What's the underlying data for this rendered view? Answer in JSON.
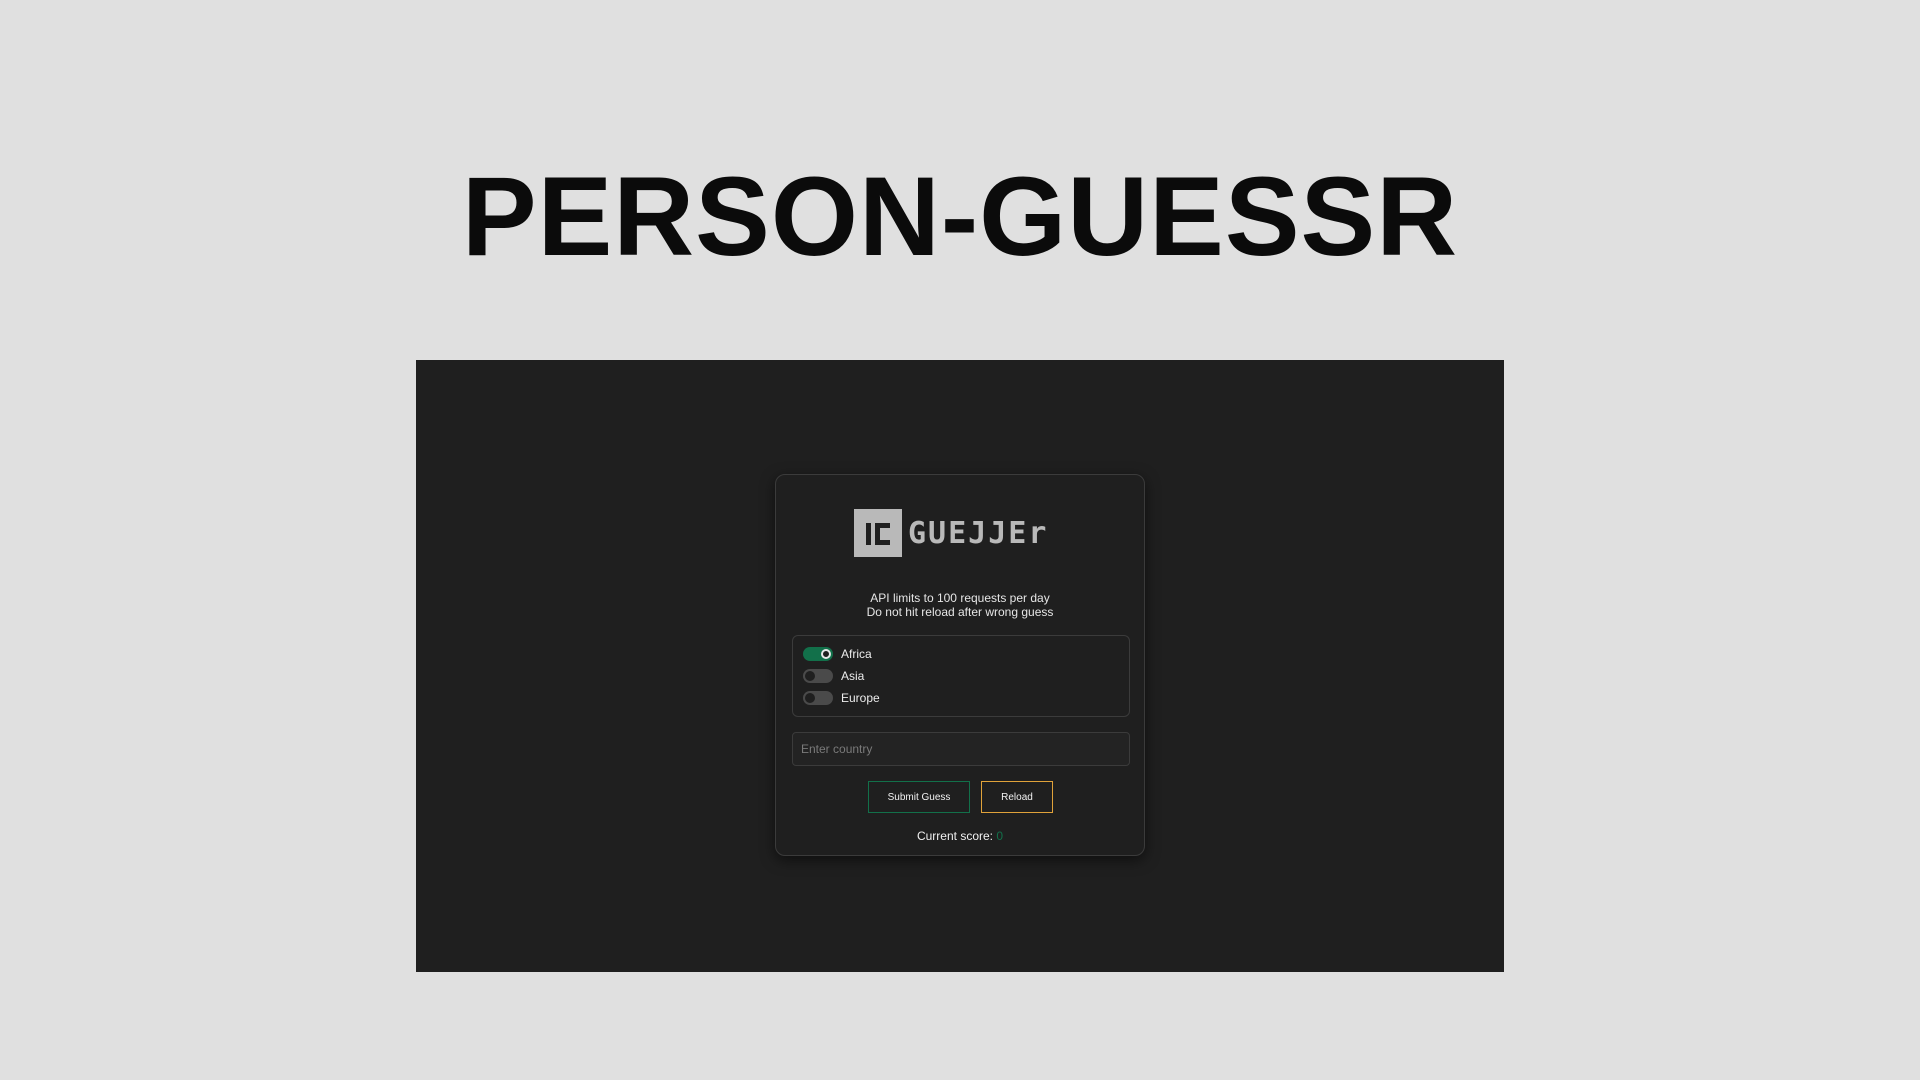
{
  "page": {
    "title": "PERSON-GUESSR"
  },
  "app": {
    "logo_text": "GUEJJEr",
    "notice_line1": "API limits to 100 requests per day",
    "notice_line2": "Do not hit reload after wrong guess",
    "regions": [
      {
        "label": "Africa",
        "enabled": true
      },
      {
        "label": "Asia",
        "enabled": false
      },
      {
        "label": "Europe",
        "enabled": false
      }
    ],
    "country_input": {
      "placeholder": "Enter country",
      "value": ""
    },
    "submit_label": "Submit Guess",
    "reload_label": "Reload",
    "score_label": "Current score:",
    "score_value": "0"
  },
  "colors": {
    "background": "#e0e0e0",
    "app_background": "#1f1f1f",
    "toggle_on": "#12704a",
    "submit_border": "#12704a",
    "reload_border": "#e0a23a"
  }
}
